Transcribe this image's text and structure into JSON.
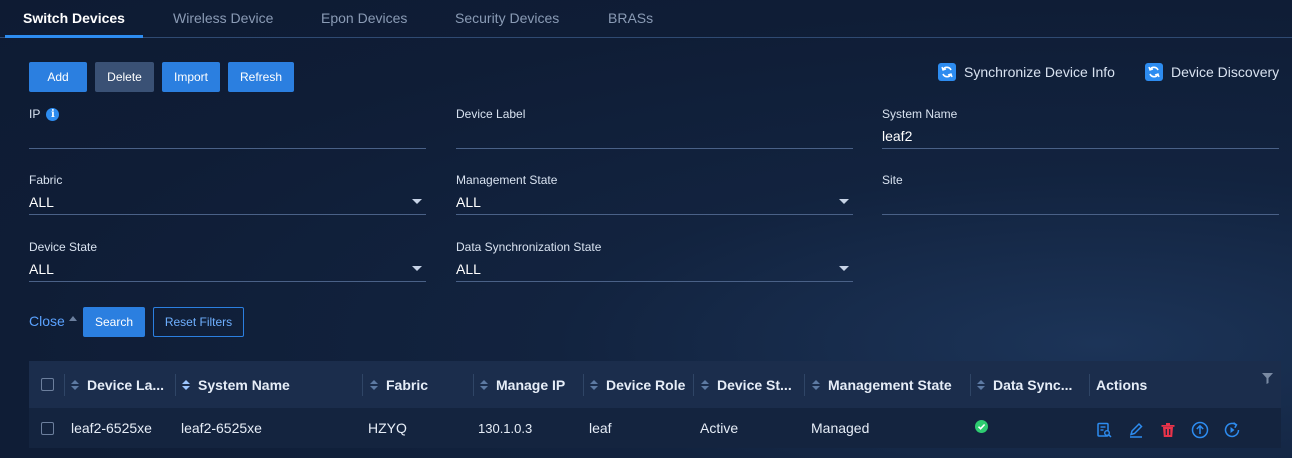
{
  "tabs": [
    {
      "label": "Switch Devices",
      "active": true
    },
    {
      "label": "Wireless Device",
      "active": false
    },
    {
      "label": "Epon Devices",
      "active": false
    },
    {
      "label": "Security Devices",
      "active": false
    },
    {
      "label": "BRASs",
      "active": false
    }
  ],
  "toolbar": {
    "add": "Add",
    "delete": "Delete",
    "import": "Import",
    "refresh": "Refresh",
    "sync_info": "Synchronize Device Info",
    "discovery": "Device Discovery"
  },
  "filters": {
    "ip": {
      "label": "IP",
      "value": ""
    },
    "device_label": {
      "label": "Device Label",
      "value": ""
    },
    "system_name": {
      "label": "System Name",
      "value": "leaf2"
    },
    "fabric": {
      "label": "Fabric",
      "value": "ALL"
    },
    "management_state": {
      "label": "Management State",
      "value": "ALL"
    },
    "site": {
      "label": "Site",
      "value": ""
    },
    "device_state": {
      "label": "Device State",
      "value": "ALL"
    },
    "data_sync_state": {
      "label": "Data Synchronization State",
      "value": "ALL"
    }
  },
  "filter_actions": {
    "close": "Close",
    "search": "Search",
    "reset": "Reset Filters"
  },
  "table": {
    "headers": [
      "Device La...",
      "System Name",
      "Fabric",
      "Manage IP",
      "Device Role",
      "Device St...",
      "Management State",
      "Data Sync...",
      "Actions"
    ],
    "rows": [
      {
        "device_label": "leaf2-6525xe",
        "system_name": "leaf2-6525xe",
        "fabric": "HZYQ",
        "manage_ip": "130.1.0.3",
        "device_role": "leaf",
        "device_state": "Active",
        "management_state": "Managed",
        "data_sync": "synchronized"
      }
    ]
  },
  "colors": {
    "accent": "#2d8cf0",
    "danger": "#e8334a",
    "success": "#2ecc71",
    "background": "#12233f"
  },
  "icons": {
    "info": "info-icon",
    "sync": "sync-icon",
    "filter": "filter-icon",
    "detail": "detail-icon",
    "edit": "edit-icon",
    "delete": "trash-icon",
    "upload": "upload-icon",
    "refresh": "refresh-icon",
    "status_ok": "check-circle-icon"
  }
}
